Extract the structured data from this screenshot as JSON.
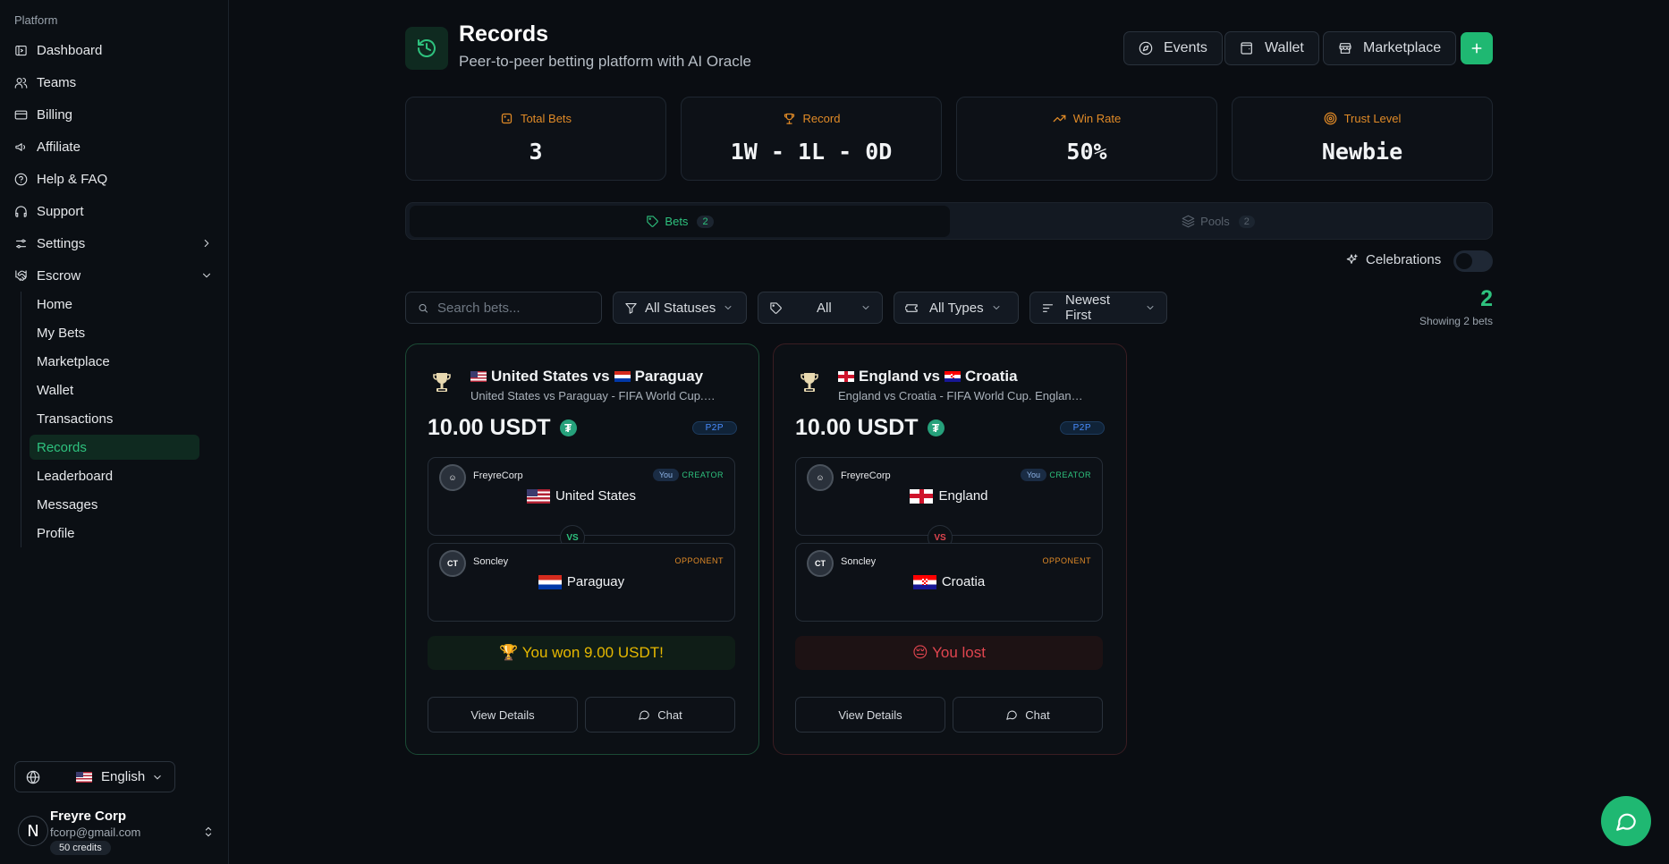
{
  "sidebar": {
    "group_label": "Platform",
    "items": [
      {
        "label": "Dashboard",
        "icon": "dashboard-icon"
      },
      {
        "label": "Teams",
        "icon": "users-icon"
      },
      {
        "label": "Billing",
        "icon": "credit-card-icon"
      },
      {
        "label": "Affiliate",
        "icon": "megaphone-icon"
      },
      {
        "label": "Help & FAQ",
        "icon": "help-circle-icon"
      },
      {
        "label": "Support",
        "icon": "headphones-icon"
      },
      {
        "label": "Settings",
        "icon": "sliders-icon"
      },
      {
        "label": "Escrow",
        "icon": "handshake-icon"
      }
    ],
    "escrow_sub": [
      "Home",
      "My Bets",
      "Marketplace",
      "Wallet",
      "Transactions",
      "Records",
      "Leaderboard",
      "Messages",
      "Profile"
    ],
    "active_sub": "Records",
    "language": "English",
    "user": {
      "initial": "N",
      "name": "Freyre Corp",
      "email": "fcorp@gmail.com",
      "credits": "50 credits"
    }
  },
  "header": {
    "title": "Records",
    "subtitle": "Peer-to-peer betting platform with AI Oracle",
    "buttons": {
      "events": "Events",
      "wallet": "Wallet",
      "marketplace": "Marketplace"
    }
  },
  "stats": [
    {
      "label": "Total Bets",
      "value": "3",
      "icon": "dice-icon"
    },
    {
      "label": "Record",
      "value": "1W - 1L - 0D",
      "icon": "trophy-icon"
    },
    {
      "label": "Win Rate",
      "value": "50%",
      "icon": "trending-up-icon"
    },
    {
      "label": "Trust Level",
      "value": "Newbie",
      "icon": "target-icon"
    }
  ],
  "tabs": [
    {
      "label": "Bets",
      "count": "2",
      "active": true
    },
    {
      "label": "Pools",
      "count": "2",
      "active": false
    }
  ],
  "celebrations": {
    "label": "Celebrations",
    "enabled": false
  },
  "filters": {
    "search_placeholder": "Search bets...",
    "status": "All Statuses",
    "tag": "All",
    "type": "All Types",
    "sort": "Newest First"
  },
  "count": {
    "value": "2",
    "label": "Showing 2 bets"
  },
  "bets": [
    {
      "outcome": "won",
      "team_a": "United States",
      "vs_word": "vs",
      "team_b": "Paraguay",
      "description": "United States vs Paraguay - FIFA World Cup. United States vs Paraguay",
      "amount": "10.00 USDT",
      "mode": "P2P",
      "creator": {
        "name": "FreyreCorp",
        "you": "You",
        "role": "CREATOR",
        "pick": "United States"
      },
      "vs_badge": "VS",
      "opponent": {
        "name": "Soncley",
        "role": "OPPONENT",
        "pick": "Paraguay"
      },
      "result": "🏆 You won 9.00 USDT!",
      "details_label": "View Details",
      "chat_label": "Chat"
    },
    {
      "outcome": "lost",
      "team_a": "England",
      "vs_word": "vs",
      "team_b": "Croatia",
      "description": "England vs Croatia - FIFA World Cup. England vs Croatia",
      "amount": "10.00 USDT",
      "mode": "P2P",
      "creator": {
        "name": "FreyreCorp",
        "you": "You",
        "role": "CREATOR",
        "pick": "England"
      },
      "vs_badge": "VS",
      "opponent": {
        "name": "Soncley",
        "role": "OPPONENT",
        "pick": "Croatia"
      },
      "result": "😔 You lost",
      "details_label": "View Details",
      "chat_label": "Chat"
    }
  ],
  "colors": {
    "accent": "#1fb872",
    "warning": "#e08a27",
    "danger": "#e0454f",
    "info": "#4a8dff"
  }
}
